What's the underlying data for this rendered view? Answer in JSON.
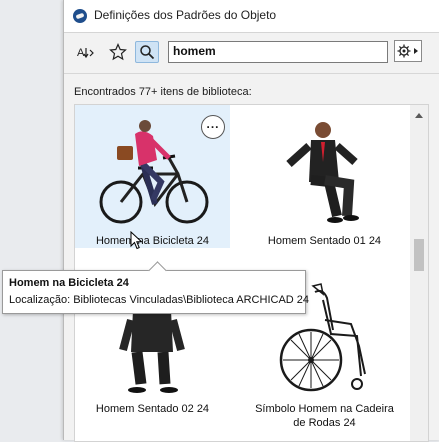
{
  "window": {
    "title": "Definições dos Padrões do Objeto"
  },
  "toolbar": {
    "search_value": "homem",
    "icons": [
      "sort-az-icon",
      "star-icon",
      "search-icon",
      "gear-icon"
    ]
  },
  "results": {
    "found_text": "Encontrados 77+ itens de biblioteca:"
  },
  "items": [
    {
      "label": "Homem na Bicicleta 24",
      "selected": true
    },
    {
      "label": "Homem Sentado 01 24",
      "selected": false
    },
    {
      "label": "Homem Sentado 02 24",
      "selected": false
    },
    {
      "label": "Símbolo Homem na Cadeira de Rodas 24",
      "label_line1": "Símbolo Homem na Cadeira",
      "label_line2": "de Rodas 24",
      "selected": false
    }
  ],
  "more_button": {
    "label": "..."
  },
  "tooltip": {
    "title": "Homem na Bicicleta 24",
    "location": "Localização: Bibliotecas Vinculadas\\Biblioteca ARCHICAD 24"
  },
  "colors": {
    "selection": "#e3f0fb",
    "active_tool": "#cfe3f5",
    "shirt": "#d8326a"
  }
}
